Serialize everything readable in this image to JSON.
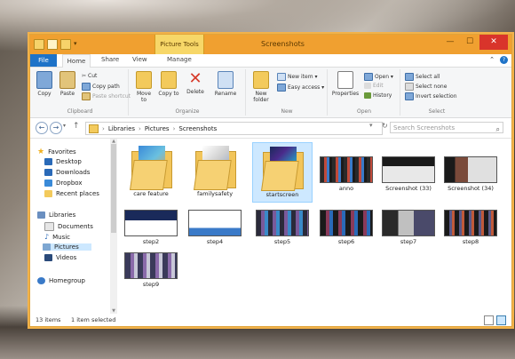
{
  "window": {
    "title": "Screenshots",
    "contextual_tab": "Picture Tools",
    "controls": {
      "minimize": "—",
      "maximize": "☐",
      "close": "✕"
    }
  },
  "ribbon_tabs": [
    "File",
    "Home",
    "Share",
    "View",
    "Manage"
  ],
  "ribbon": {
    "clipboard": {
      "name": "Clipboard",
      "copy": "Copy",
      "paste": "Paste",
      "cut": "Cut",
      "copy_path": "Copy path",
      "paste_shortcut": "Paste shortcut"
    },
    "organize": {
      "name": "Organize",
      "move_to": "Move to",
      "copy_to": "Copy to",
      "delete": "Delete",
      "rename": "Rename"
    },
    "new": {
      "name": "New",
      "new_folder": "New folder",
      "new_item": "New item ▾",
      "easy_access": "Easy access ▾"
    },
    "open": {
      "name": "Open",
      "properties": "Properties",
      "open": "Open ▾",
      "edit": "Edit",
      "history": "History"
    },
    "select": {
      "name": "Select",
      "select_all": "Select all",
      "select_none": "Select none",
      "invert": "Invert selection"
    }
  },
  "address": {
    "crumbs": [
      "Libraries",
      "Pictures",
      "Screenshots"
    ],
    "search_placeholder": "Search Screenshots"
  },
  "nav": {
    "favorites": "Favorites",
    "desktop": "Desktop",
    "downloads": "Downloads",
    "dropbox": "Dropbox",
    "recent": "Recent places",
    "libraries": "Libraries",
    "documents": "Documents",
    "music": "Music",
    "pictures": "Pictures",
    "videos": "Videos",
    "homegroup": "Homegroup"
  },
  "files": [
    {
      "name": "care feature",
      "kind": "folder"
    },
    {
      "name": "familysafety",
      "kind": "folder"
    },
    {
      "name": "startscreen",
      "kind": "folder",
      "selected": true
    },
    {
      "name": "anno",
      "kind": "image"
    },
    {
      "name": "Screenshot (33)",
      "kind": "image"
    },
    {
      "name": "Screenshot (34)",
      "kind": "image"
    },
    {
      "name": "step2",
      "kind": "image"
    },
    {
      "name": "step4",
      "kind": "image"
    },
    {
      "name": "step5",
      "kind": "image"
    },
    {
      "name": "step6",
      "kind": "image"
    },
    {
      "name": "step7",
      "kind": "image"
    },
    {
      "name": "step8",
      "kind": "image"
    },
    {
      "name": "step9",
      "kind": "image"
    }
  ],
  "status": {
    "count": "13 items",
    "selected": "1 item selected"
  }
}
